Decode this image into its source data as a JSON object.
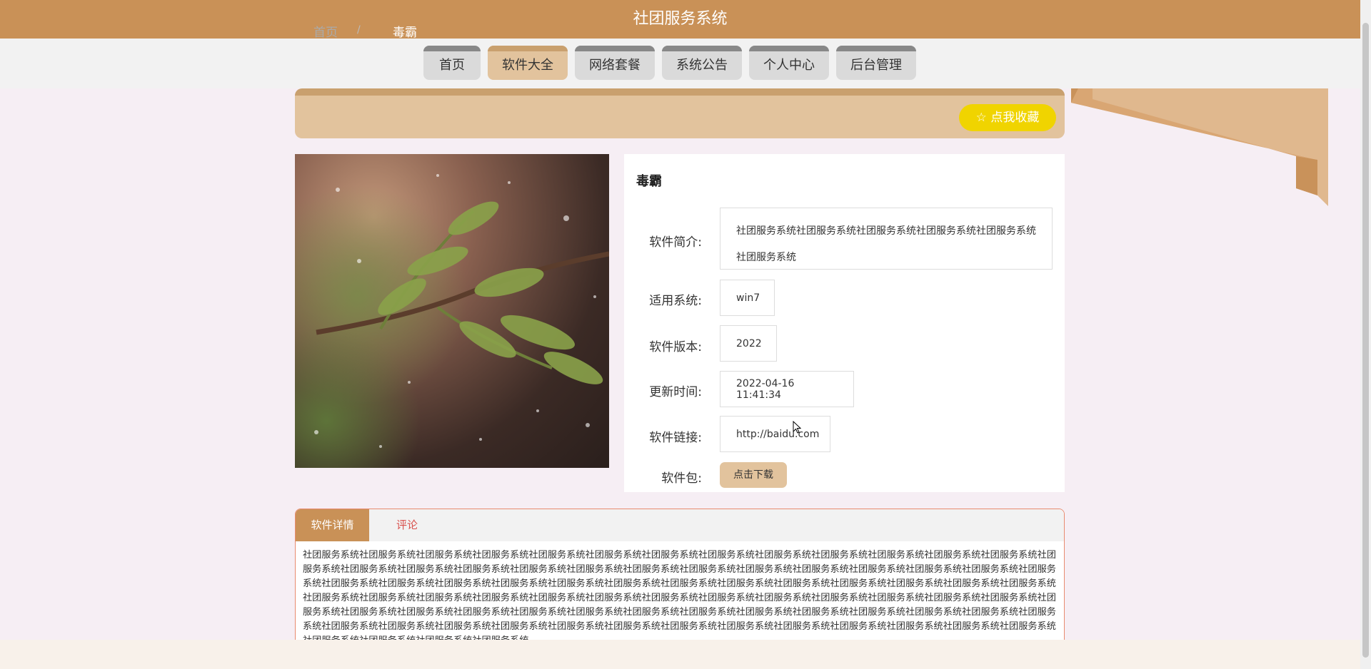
{
  "header": {
    "title": "社团服务系统"
  },
  "nav": {
    "items": [
      {
        "label": "首页"
      },
      {
        "label": "软件大全"
      },
      {
        "label": "网络套餐"
      },
      {
        "label": "系统公告"
      },
      {
        "label": "个人中心"
      },
      {
        "label": "后台管理"
      }
    ],
    "active_index": 1
  },
  "breadcrumb": {
    "home": "首页",
    "separator": "/",
    "current": "毒霸"
  },
  "favorite_button": {
    "label": "☆ 点我收藏"
  },
  "software": {
    "name": "毒霸",
    "fields": [
      {
        "label": "软件简介:",
        "value": "社团服务系统社团服务系统社团服务系统社团服务系统社团服务系统社团服务系统"
      },
      {
        "label": "适用系统:",
        "value": "win7"
      },
      {
        "label": "软件版本:",
        "value": "2022"
      },
      {
        "label": "更新时间:",
        "value": "2022-04-16 11:41:34"
      },
      {
        "label": "软件链接:",
        "value": "http://baidu.com"
      }
    ],
    "package_label": "软件包:",
    "download_label": "点击下载"
  },
  "tabs": {
    "items": [
      {
        "label": "软件详情"
      },
      {
        "label": "评论"
      }
    ],
    "active_index": 0,
    "detail_text": "社团服务系统社团服务系统社团服务系统社团服务系统社团服务系统社团服务系统社团服务系统社团服务系统社团服务系统社团服务系统社团服务系统社团服务系统社团服务系统社团服务系统社团服务系统社团服务系统社团服务系统社团服务系统社团服务系统社团服务系统社团服务系统社团服务系统社团服务系统社团服务系统社团服务系统社团服务系统社团服务系统社团服务系统社团服务系统社团服务系统社团服务系统社团服务系统社团服务系统社团服务系统社团服务系统社团服务系统社团服务系统社团服务系统社团服务系统社团服务系统社团服务系统社团服务系统社团服务系统社团服务系统社团服务系统社团服务系统社团服务系统社团服务系统社团服务系统社团服务系统社团服务系统社团服务系统社团服务系统社团服务系统社团服务系统社团服务系统社团服务系统社团服务系统社团服务系统社团服务系统社团服务系统社团服务系统社团服务系统社团服务系统社团服务系统社团服务系统社团服务系统社团服务系统社团服务系统社团服务系统社团服务系统社团服务系统社团服务系统社团服务系统社团服务系统社团服务系统社团服务系统社团服务系统社团服务系统社团服务系统社团服务系统社团服务系统社团服务系统社团服务系统"
  },
  "colors": {
    "brand": "#c99157",
    "accent_light": "#e2c39d",
    "favorite": "#f0d400",
    "comment_tab": "#d9534f"
  }
}
